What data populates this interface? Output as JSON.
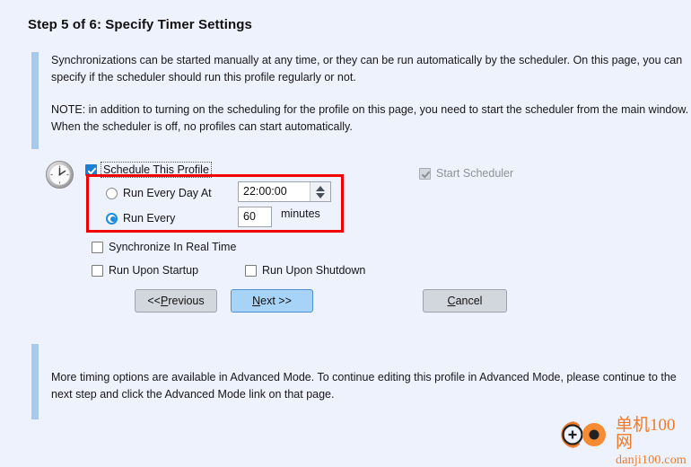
{
  "window": {
    "background_color": "#eef2fc",
    "accent_bar_color": "#a9c9ec",
    "highlight_color": "#f20000"
  },
  "title": "Step 5 of 6: Specify Timer Settings",
  "info_top": {
    "paragraph1": "Synchronizations can be started manually at any time, or they can be run automatically by the scheduler. On this page, you can specify if the scheduler should run this profile regularly or not.",
    "paragraph2": "NOTE: in addition to turning on the scheduling for the profile on this page, you need to start the scheduler from the main window. When the scheduler is off, no profiles can start automatically."
  },
  "info_bottom": {
    "paragraph1": "More timing options are available in Advanced Mode. To continue editing this profile in Advanced Mode, please continue to the next step and click the Advanced Mode link on that page."
  },
  "form": {
    "icon": "clock-icon",
    "schedule_profile": {
      "label": "Schedule This Profile",
      "checked": true,
      "focused": true
    },
    "start_scheduler": {
      "label": "Start Scheduler",
      "checked": true,
      "disabled": true
    },
    "run_every_day_at": {
      "label": "Run Every Day At",
      "selected": false,
      "time_value": "22:00:00"
    },
    "run_every": {
      "label": "Run Every",
      "selected": true,
      "interval_value": "60",
      "unit_label": "minutes"
    },
    "synchronize_real_time": {
      "label": "Synchronize In Real Time",
      "checked": false
    },
    "run_upon_startup": {
      "label": "Run Upon Startup",
      "checked": false
    },
    "run_upon_shutdown": {
      "label": "Run Upon Shutdown",
      "checked": false
    }
  },
  "buttons": {
    "previous": {
      "prefix": "<< ",
      "accel": "P",
      "suffix": "revious"
    },
    "next": {
      "prefix": "",
      "accel": "N",
      "suffix": "ext >>"
    },
    "cancel": {
      "prefix": "",
      "accel": "C",
      "suffix": "ancel"
    }
  },
  "watermark": {
    "chinese": "单机100网",
    "english": "danji100.com",
    "color": "#f07a28"
  }
}
